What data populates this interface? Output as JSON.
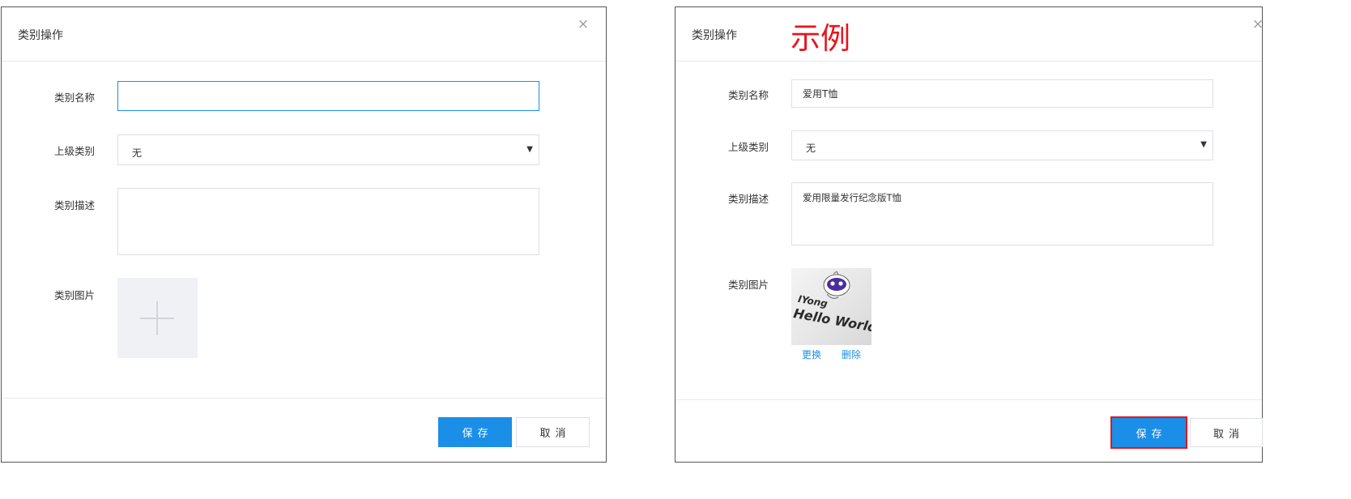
{
  "left_dialog": {
    "title": "类别操作",
    "close_glyph": "×",
    "fields": {
      "name": {
        "label": "类别名称",
        "value": "",
        "placeholder": ""
      },
      "parent": {
        "label": "上级类别",
        "selected": "无"
      },
      "description": {
        "label": "类别描述",
        "value": ""
      },
      "image": {
        "label": "类别图片"
      }
    },
    "buttons": {
      "save": "保存",
      "cancel": "取消"
    }
  },
  "right_dialog": {
    "title": "类别操作",
    "annotation": "示例",
    "close_glyph": "×",
    "fields": {
      "name": {
        "label": "类别名称",
        "value": "爱用T恤"
      },
      "parent": {
        "label": "上级类别",
        "selected": "无"
      },
      "description": {
        "label": "类别描述",
        "value": "爱用限量发行纪念版T恤"
      },
      "image": {
        "label": "类别图片",
        "thumbnail_text": {
          "line1": "IYong",
          "line2": "Hello World"
        },
        "replace_label": "更换",
        "delete_label": "删除"
      }
    },
    "buttons": {
      "save": "保存",
      "cancel": "取消"
    }
  },
  "icons": {
    "close": "close-icon",
    "caret": "caret-down-icon",
    "plus": "plus-icon",
    "mascot": "mascot-icon"
  },
  "colors": {
    "primary": "#1b8ee8",
    "annotation": "#e8151b",
    "highlight_box": "#e8151b",
    "input_border": "#dcdfe6",
    "upload_bg": "#f0f1f5"
  }
}
